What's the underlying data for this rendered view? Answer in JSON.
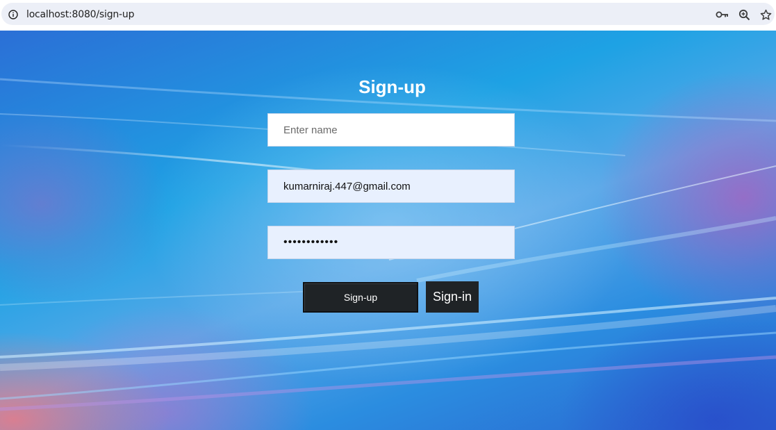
{
  "browser": {
    "url": "localhost:8080/sign-up",
    "icons": [
      "site-info-icon",
      "key-icon",
      "zoom-icon",
      "star-icon"
    ]
  },
  "form": {
    "title": "Sign-up",
    "name_placeholder": "Enter name",
    "name_value": "",
    "email_value": "kumarniraj.447@gmail.com",
    "password_value": "••••••••••••",
    "signup_label": "Sign-up",
    "signin_label": "Sign-in"
  },
  "colors": {
    "button_bg": "#1f2326",
    "autofill_bg": "#e8f0fe",
    "title": "#ffffff"
  }
}
